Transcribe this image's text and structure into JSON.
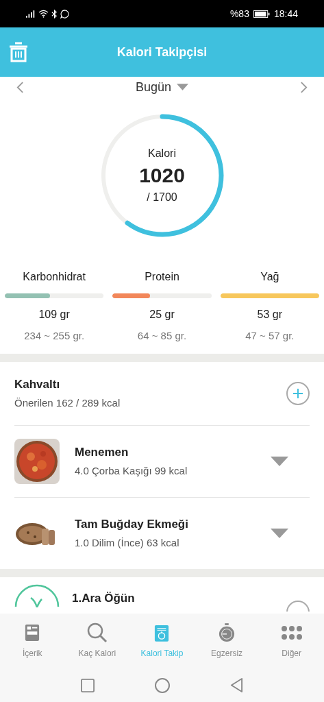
{
  "status_bar": {
    "battery": "%83",
    "time": "18:44"
  },
  "header": {
    "title": "Kalori Takipçisi"
  },
  "date": {
    "label": "Bugün"
  },
  "calories": {
    "label": "Kalori",
    "value": "1020",
    "goal": "/ 1700"
  },
  "macros": [
    {
      "name": "Karbonhidrat",
      "color": "#93c1b2",
      "level": 0.46,
      "amount": "109 gr",
      "range": "234 ~ 255 gr."
    },
    {
      "name": "Protein",
      "color": "#f2875a",
      "level": 0.38,
      "amount": "25 gr",
      "range": "64 ~ 85 gr."
    },
    {
      "name": "Yağ",
      "color": "#f7c75c",
      "level": 1,
      "amount": "53 gr",
      "range": "47 ~ 57 gr."
    }
  ],
  "meals": [
    {
      "title": "Kahvaltı",
      "subtitle": "Önerilen 162 / 289 kcal",
      "foods": [
        {
          "name": "Menemen",
          "detail": "4.0 Çorba Kaşığı 99 kcal",
          "kind": "picture"
        },
        {
          "name": "Tam Buğday Ekmeği",
          "detail": "1.0 Dilim (İnce) 63 kcal",
          "kind": "picture"
        }
      ]
    },
    {
      "title": "1.Ara Öğün"
    }
  ],
  "tabs": [
    {
      "label": "İçerik",
      "selected": false
    },
    {
      "label": "Kaç Kalori",
      "selected": false
    },
    {
      "label": "Kalori Takip",
      "selected": true
    },
    {
      "label": "Egzersiz",
      "selected": false
    },
    {
      "label": "Diğer",
      "selected": false
    }
  ]
}
